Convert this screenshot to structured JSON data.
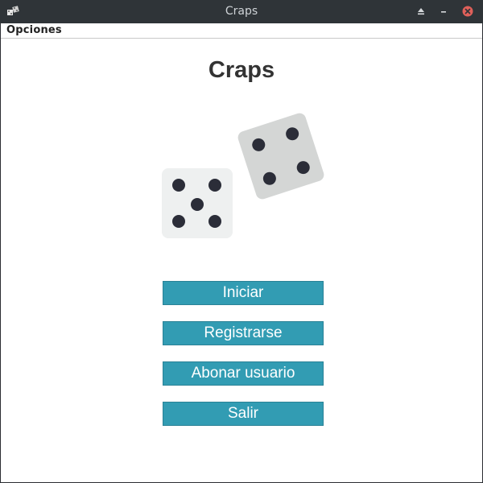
{
  "window": {
    "title": "Craps",
    "app_icon": "dice-icon",
    "controls": [
      "eject-icon",
      "minimize-icon",
      "close-icon"
    ]
  },
  "menubar": {
    "items": [
      {
        "label": "Opciones"
      }
    ]
  },
  "main": {
    "heading": "Craps",
    "illustration": {
      "dice": [
        {
          "name": "die-five",
          "pips": 5
        },
        {
          "name": "die-four",
          "pips": 4
        }
      ]
    },
    "buttons": [
      {
        "label": "Iniciar"
      },
      {
        "label": "Registrarse"
      },
      {
        "label": "Abonar usuario"
      },
      {
        "label": "Salir"
      }
    ]
  },
  "colors": {
    "button_bg": "#329cb3",
    "button_text": "#ffffff",
    "titlebar_bg": "#2f3438",
    "close_button": "#e0605a",
    "die_light": "#eef0f0",
    "die_gray": "#d4d6d5",
    "pip": "#2b2d38"
  }
}
